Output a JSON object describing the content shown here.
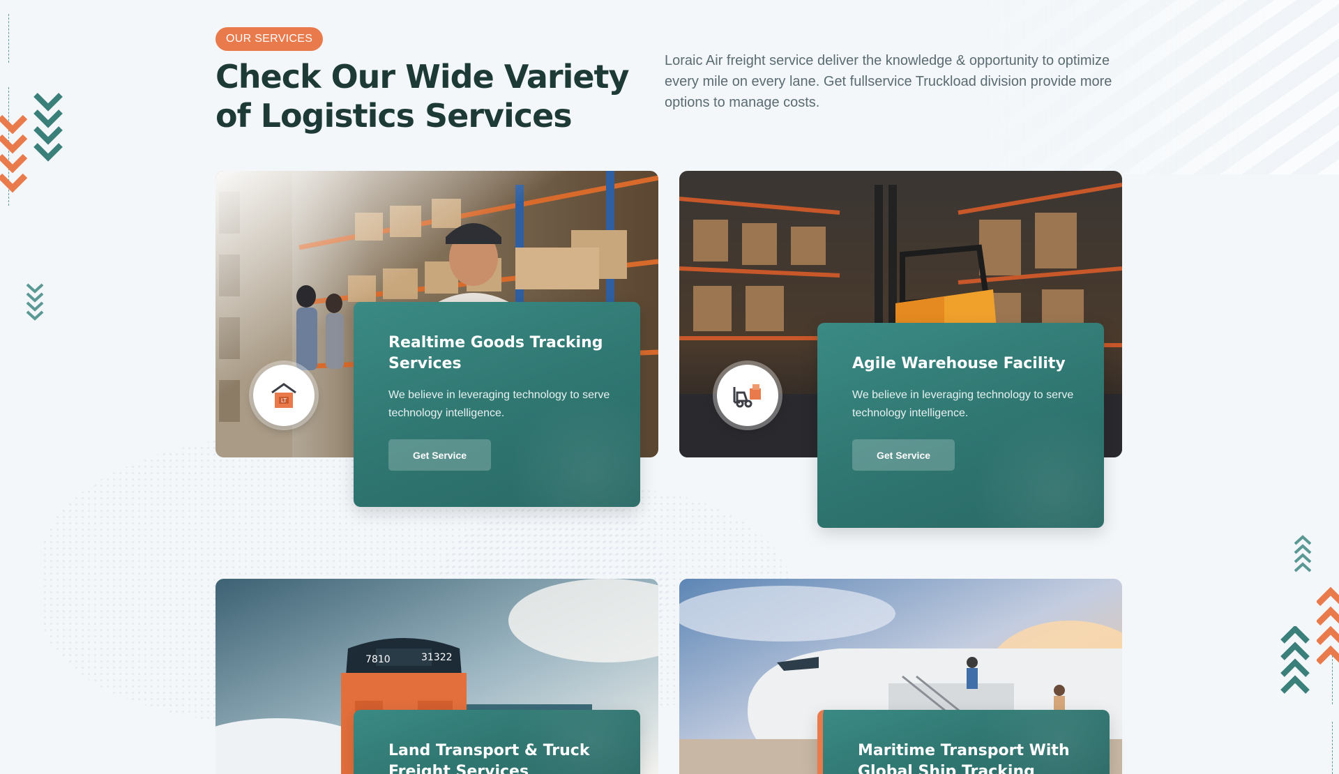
{
  "section": {
    "badge": "OUR SERVICES",
    "title": "Check Our Wide Variety of Logistics Services",
    "intro": "Loraic Air freight service deliver the knowledge & opportunity to optimize every mile on every lane. Get fullservice Truckload division provide more options to manage costs."
  },
  "services": [
    {
      "title": "Realtime Goods Tracking Services",
      "description": "We believe in leveraging technology to serve technology intelligence.",
      "button": "Get Service",
      "icon": "package-tracking-icon",
      "image": "warehouse-worker-photo"
    },
    {
      "title": "Agile Warehouse Facility",
      "description": "We believe in leveraging technology to serve technology intelligence.",
      "button": "Get Service",
      "icon": "forklift-icon",
      "image": "forklift-warehouse-photo"
    },
    {
      "title": "Land Transport & Truck Freight Services",
      "image": "freight-train-photo"
    },
    {
      "title": "Maritime Transport With Global Ship Tracking",
      "image": "airplane-boarding-photo"
    }
  ],
  "colors": {
    "brand_orange": "#e97a4c",
    "brand_teal": "#347f79",
    "heading_dark": "#1d3a36",
    "background": "#f3f7fa"
  }
}
